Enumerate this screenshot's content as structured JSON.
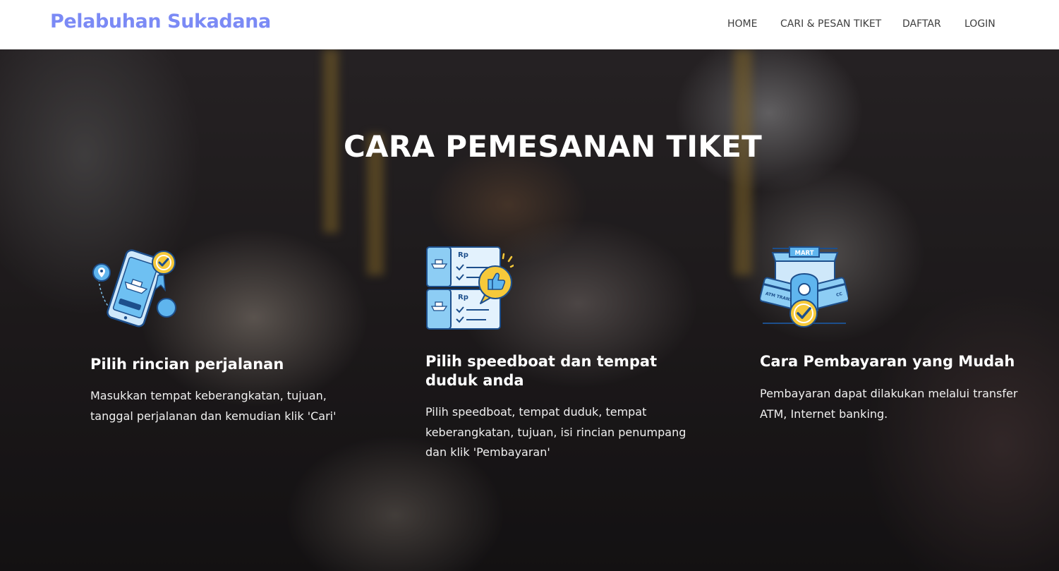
{
  "brand": "Pelabuhan Sukadana",
  "nav": {
    "home": "HOME",
    "search": "CARI & PESAN TIKET",
    "register": "DAFTAR",
    "login": "LOGIN"
  },
  "section": {
    "title": "CARA PEMESANAN TIKET"
  },
  "steps": [
    {
      "icon": "phone-boat-icon",
      "title": "Pilih rincian perjalanan",
      "desc": "Masukkan tempat keberangkatan, tujuan, tanggal perjalanan dan kemudian klik 'Cari'"
    },
    {
      "icon": "tickets-thumbsup-icon",
      "title": "Pilih speedboat dan tempat duduk anda",
      "desc": "Pilih speedboat, tempat duduk, tempat keberangkatan, tujuan, isi rincian penumpang dan klik 'Pembayaran'"
    },
    {
      "icon": "payment-cards-icon",
      "title": "Cara Pembayaran yang Mudah",
      "desc": "Pembayaran dapat dilakukan melalui transfer ATM, Internet banking."
    }
  ],
  "icon_labels": {
    "price_tag": "Rp",
    "store_sign": "MART",
    "atm_card": "ATM TRANSFER",
    "cc_card": "CC"
  },
  "colors": {
    "brand": "#7b8af5",
    "icon_blue": "#5fb5ee",
    "icon_dark": "#1d4f8c",
    "icon_yellow": "#f6c93a",
    "nav_text": "#3d3d3d",
    "hero_text": "#ffffff"
  }
}
